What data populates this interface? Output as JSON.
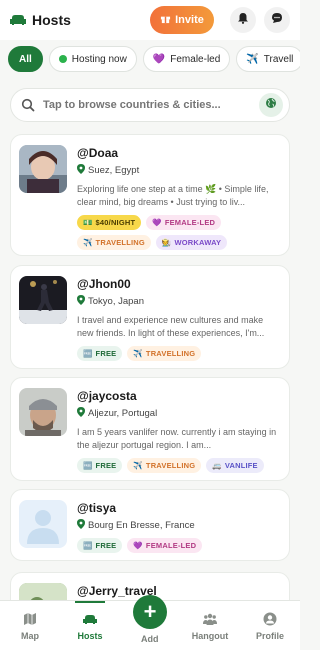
{
  "header": {
    "title": "Hosts",
    "invite_label": "Invite"
  },
  "filters": [
    {
      "label": "All",
      "active": true
    },
    {
      "label": "Hosting now"
    },
    {
      "label": "Female-led"
    },
    {
      "label": "Travell"
    }
  ],
  "search": {
    "placeholder": "Tap to browse countries & cities..."
  },
  "hosts": [
    {
      "username": "@Doaa",
      "location": "Suez, Egypt",
      "bio": "Exploring life one step at a time 🌿 • Simple life, clear mind, big dreams • Just trying to liv...",
      "tags": [
        {
          "label": "$40/NIGHT",
          "type": "price",
          "icon": "💵"
        },
        {
          "label": "FEMALE-LED",
          "type": "female",
          "icon": "💜"
        },
        {
          "label": "TRAVELLING",
          "type": "travel",
          "icon": "✈️"
        },
        {
          "label": "WORKAWAY",
          "type": "work",
          "icon": "🧑‍🌾"
        }
      ]
    },
    {
      "username": "@Jhon00",
      "location": "Tokyo, Japan",
      "bio": "I travel and experience new cultures and make new friends. In light of these experiences, I'm...",
      "tags": [
        {
          "label": "FREE",
          "type": "free",
          "icon": "🆓"
        },
        {
          "label": "TRAVELLING",
          "type": "travel",
          "icon": "✈️"
        }
      ]
    },
    {
      "username": "@jaycosta",
      "location": "Aljezur, Portugal",
      "bio": "I am 5 years vanlifer now. currently i am staying in the aljezur portugal region. I am...",
      "tags": [
        {
          "label": "FREE",
          "type": "free",
          "icon": "🆓"
        },
        {
          "label": "TRAVELLING",
          "type": "travel",
          "icon": "✈️"
        },
        {
          "label": "VANLIFE",
          "type": "van",
          "icon": "🚐"
        }
      ]
    },
    {
      "username": "@tisya",
      "location": "Bourg En Bresse, France",
      "bio": "",
      "tags": [
        {
          "label": "FREE",
          "type": "free",
          "icon": "🆓"
        },
        {
          "label": "FEMALE-LED",
          "type": "female",
          "icon": "💜"
        }
      ]
    },
    {
      "username": "@Jerry_travel",
      "location": "",
      "bio": "",
      "tags": []
    }
  ],
  "nav": {
    "map": "Map",
    "hosts": "Hosts",
    "add": "Add",
    "hangout": "Hangout",
    "profile": "Profile"
  },
  "colors": {
    "brand_green": "#1f7a3a",
    "invite_orange": "#f2713a"
  }
}
